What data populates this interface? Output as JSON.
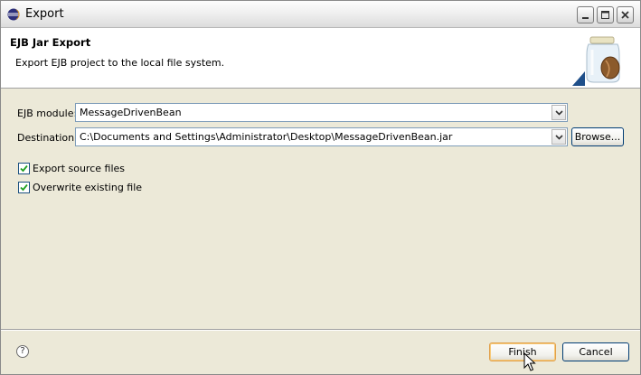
{
  "window": {
    "title": "Export"
  },
  "banner": {
    "title": "EJB Jar Export",
    "message": "Export EJB project to the local file system."
  },
  "form": {
    "ejb_module_label": "EJB module:",
    "ejb_module_value": "MessageDrivenBean",
    "destination_label": "Destination:",
    "destination_value": "C:\\Documents and Settings\\Administrator\\Desktop\\MessageDrivenBean.jar",
    "browse_label": "Browse...",
    "export_source_label": "Export source files",
    "overwrite_label": "Overwrite existing file"
  },
  "footer": {
    "help_glyph": "?",
    "finish_label": "Finish",
    "cancel_label": "Cancel"
  }
}
